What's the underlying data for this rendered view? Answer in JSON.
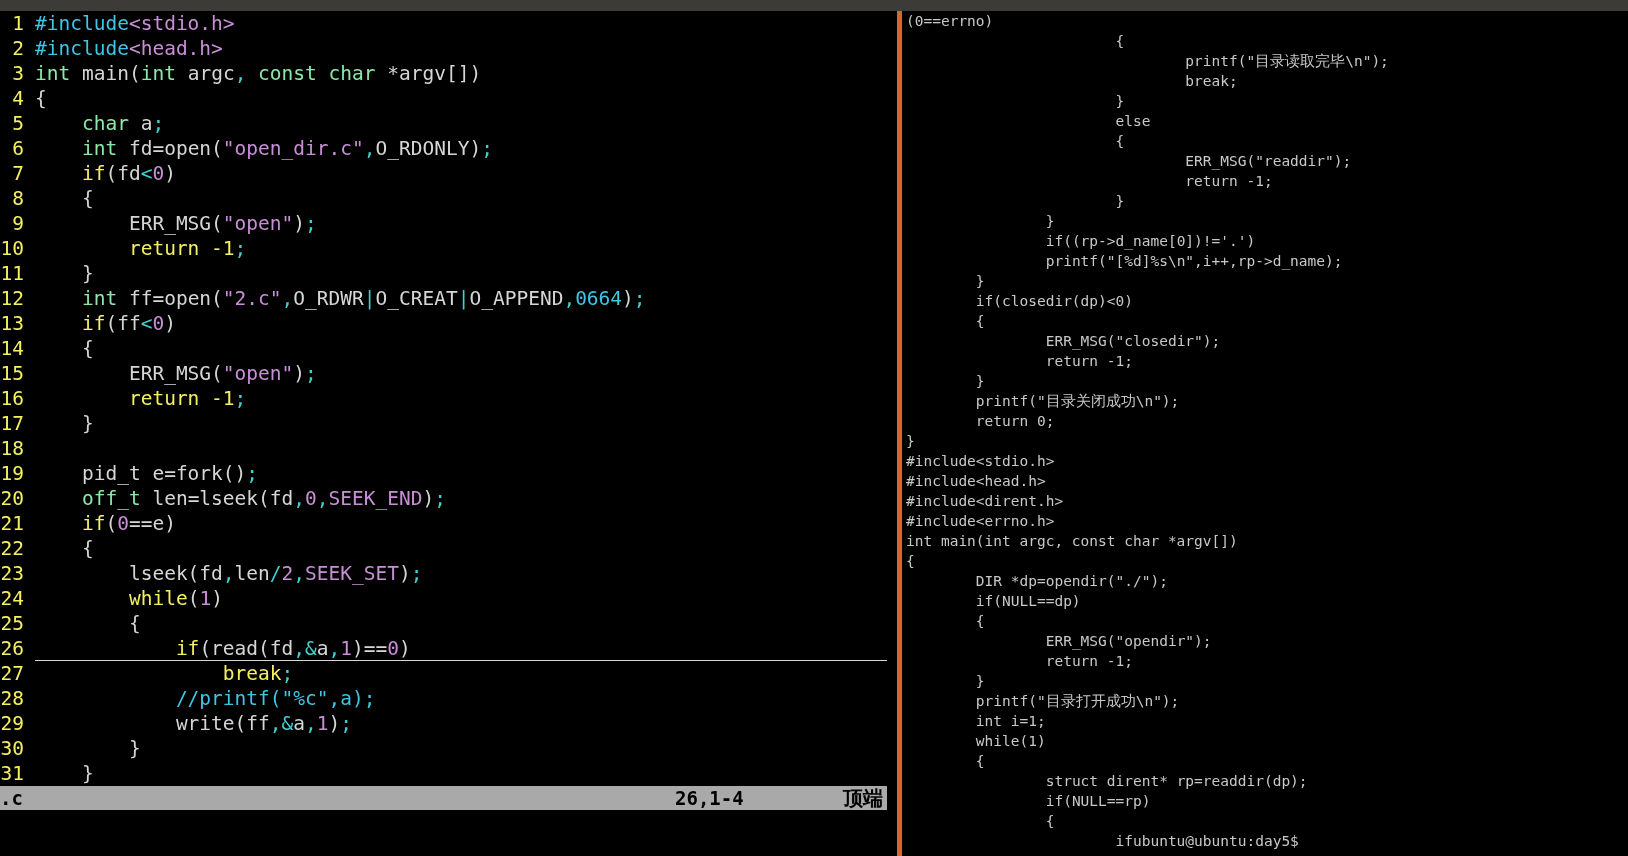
{
  "editor": {
    "lines": [
      {
        "number": "1",
        "segments": [
          {
            "kind": "preproc",
            "text": "#include"
          },
          {
            "kind": "string",
            "text": "<stdio.h>"
          }
        ]
      },
      {
        "number": "2",
        "segments": [
          {
            "kind": "preproc",
            "text": "#include"
          },
          {
            "kind": "string",
            "text": "<head.h>"
          }
        ]
      },
      {
        "number": "3",
        "segments": [
          {
            "kind": "type",
            "text": "int"
          },
          {
            "kind": "plain",
            "text": " main("
          },
          {
            "kind": "type",
            "text": "int"
          },
          {
            "kind": "plain",
            "text": " argc"
          },
          {
            "kind": "punct",
            "text": ", "
          },
          {
            "kind": "type",
            "text": "const char"
          },
          {
            "kind": "plain",
            "text": " *argv[])"
          }
        ]
      },
      {
        "number": "4",
        "segments": [
          {
            "kind": "plain",
            "text": "{"
          }
        ]
      },
      {
        "number": "5",
        "segments": [
          {
            "kind": "type",
            "text": "    char"
          },
          {
            "kind": "plain",
            "text": " a"
          },
          {
            "kind": "punct",
            "text": ";"
          }
        ]
      },
      {
        "number": "6",
        "segments": [
          {
            "kind": "type",
            "text": "    int"
          },
          {
            "kind": "plain",
            "text": " fd=open("
          },
          {
            "kind": "string",
            "text": "\"open_dir.c\""
          },
          {
            "kind": "punct",
            "text": ","
          },
          {
            "kind": "plain",
            "text": "O_RDONLY)"
          },
          {
            "kind": "punct",
            "text": ";"
          }
        ]
      },
      {
        "number": "7",
        "segments": [
          {
            "kind": "statement",
            "text": "    if"
          },
          {
            "kind": "plain",
            "text": "(fd"
          },
          {
            "kind": "punct",
            "text": "<"
          },
          {
            "kind": "number",
            "text": "0"
          },
          {
            "kind": "plain",
            "text": ")"
          }
        ]
      },
      {
        "number": "8",
        "segments": [
          {
            "kind": "plain",
            "text": "    {"
          }
        ]
      },
      {
        "number": "9",
        "segments": [
          {
            "kind": "plain",
            "text": "        ERR_MSG("
          },
          {
            "kind": "string",
            "text": "\"open\""
          },
          {
            "kind": "plain",
            "text": ")"
          },
          {
            "kind": "punct",
            "text": ";"
          }
        ]
      },
      {
        "number": "10",
        "segments": [
          {
            "kind": "statement",
            "text": "        return -1"
          },
          {
            "kind": "punct",
            "text": ";"
          }
        ]
      },
      {
        "number": "11",
        "segments": [
          {
            "kind": "plain",
            "text": "    }"
          }
        ]
      },
      {
        "number": "12",
        "segments": [
          {
            "kind": "type",
            "text": "    int"
          },
          {
            "kind": "plain",
            "text": " ff=open("
          },
          {
            "kind": "string",
            "text": "\"2.c\""
          },
          {
            "kind": "punct",
            "text": ","
          },
          {
            "kind": "plain",
            "text": "O_RDWR"
          },
          {
            "kind": "punct",
            "text": "|"
          },
          {
            "kind": "plain",
            "text": "O_CREAT"
          },
          {
            "kind": "punct",
            "text": "|"
          },
          {
            "kind": "plain",
            "text": "O_APPEND"
          },
          {
            "kind": "punct",
            "text": ","
          },
          {
            "kind": "octal",
            "text": "0664"
          },
          {
            "kind": "plain",
            "text": ")"
          },
          {
            "kind": "punct",
            "text": ";"
          }
        ]
      },
      {
        "number": "13",
        "segments": [
          {
            "kind": "statement",
            "text": "    if"
          },
          {
            "kind": "plain",
            "text": "(ff"
          },
          {
            "kind": "punct",
            "text": "<"
          },
          {
            "kind": "number",
            "text": "0"
          },
          {
            "kind": "plain",
            "text": ")"
          }
        ]
      },
      {
        "number": "14",
        "segments": [
          {
            "kind": "plain",
            "text": "    {"
          }
        ]
      },
      {
        "number": "15",
        "segments": [
          {
            "kind": "plain",
            "text": "        ERR_MSG("
          },
          {
            "kind": "string",
            "text": "\"open\""
          },
          {
            "kind": "plain",
            "text": ")"
          },
          {
            "kind": "punct",
            "text": ";"
          }
        ]
      },
      {
        "number": "16",
        "segments": [
          {
            "kind": "statement",
            "text": "        return -1"
          },
          {
            "kind": "punct",
            "text": ";"
          }
        ]
      },
      {
        "number": "17",
        "segments": [
          {
            "kind": "plain",
            "text": "    }"
          }
        ]
      },
      {
        "number": "18"
      },
      {
        "number": "19",
        "segments": [
          {
            "kind": "plain",
            "text": "    pid_t e=fork()"
          },
          {
            "kind": "punct",
            "text": ";"
          }
        ]
      },
      {
        "number": "20",
        "segments": [
          {
            "kind": "type",
            "text": "    off_t"
          },
          {
            "kind": "plain",
            "text": " len=lseek(fd"
          },
          {
            "kind": "punct",
            "text": ","
          },
          {
            "kind": "number",
            "text": "0"
          },
          {
            "kind": "punct",
            "text": ","
          },
          {
            "kind": "number",
            "text": "SEEK_END"
          },
          {
            "kind": "plain",
            "text": ")"
          },
          {
            "kind": "punct",
            "text": ";"
          }
        ]
      },
      {
        "number": "21",
        "segments": [
          {
            "kind": "statement",
            "text": "    if"
          },
          {
            "kind": "plain",
            "text": "("
          },
          {
            "kind": "number",
            "text": "0"
          },
          {
            "kind": "plain",
            "text": "==e)"
          }
        ]
      },
      {
        "number": "22",
        "segments": [
          {
            "kind": "plain",
            "text": "    {"
          }
        ]
      },
      {
        "number": "23",
        "segments": [
          {
            "kind": "plain",
            "text": "        lseek(fd"
          },
          {
            "kind": "punct",
            "text": ","
          },
          {
            "kind": "plain",
            "text": "len"
          },
          {
            "kind": "punct",
            "text": "/"
          },
          {
            "kind": "number",
            "text": "2"
          },
          {
            "kind": "punct",
            "text": ","
          },
          {
            "kind": "number",
            "text": "SEEK_SET"
          },
          {
            "kind": "plain",
            "text": ")"
          },
          {
            "kind": "punct",
            "text": ";"
          }
        ]
      },
      {
        "number": "24",
        "segments": [
          {
            "kind": "statement",
            "text": "        while"
          },
          {
            "kind": "plain",
            "text": "("
          },
          {
            "kind": "number",
            "text": "1"
          },
          {
            "kind": "plain",
            "text": ")"
          }
        ]
      },
      {
        "number": "25",
        "segments": [
          {
            "kind": "plain",
            "text": "        {"
          }
        ]
      },
      {
        "number": "26",
        "cursorline": true,
        "segments": [
          {
            "kind": "statement",
            "text": "            if"
          },
          {
            "kind": "plain",
            "text": "(read(fd"
          },
          {
            "kind": "punct",
            "text": ",&"
          },
          {
            "kind": "plain",
            "text": "a"
          },
          {
            "kind": "punct",
            "text": ","
          },
          {
            "kind": "number",
            "text": "1"
          },
          {
            "kind": "plain",
            "text": ")=="
          },
          {
            "kind": "number",
            "text": "0"
          },
          {
            "kind": "plain",
            "text": ")"
          }
        ]
      },
      {
        "number": "27",
        "segments": [
          {
            "kind": "statement",
            "text": "                break"
          },
          {
            "kind": "punct",
            "text": ";"
          }
        ]
      },
      {
        "number": "28",
        "segments": [
          {
            "kind": "comment",
            "text": "            //printf(\"%c\",a);"
          }
        ]
      },
      {
        "number": "29",
        "segments": [
          {
            "kind": "plain",
            "text": "            write(ff"
          },
          {
            "kind": "punct",
            "text": ",&"
          },
          {
            "kind": "plain",
            "text": "a"
          },
          {
            "kind": "punct",
            "text": ","
          },
          {
            "kind": "number",
            "text": "1"
          },
          {
            "kind": "plain",
            "text": ")"
          },
          {
            "kind": "punct",
            "text": ";"
          }
        ]
      },
      {
        "number": "30",
        "segments": [
          {
            "kind": "plain",
            "text": "        }"
          }
        ]
      },
      {
        "number": "31",
        "segments": [
          {
            "kind": "plain",
            "text": "    }"
          }
        ]
      }
    ],
    "status_bar": {
      "file": ".c",
      "position": "26,1-4",
      "scroll": "顶端"
    }
  },
  "terminal": {
    "lines": [
      "(0==errno)",
      "\t\t\t{",
      "\t\t\t\tprintf(\"目录读取完毕\\n\");",
      "\t\t\t\tbreak;",
      "\t\t\t}",
      "\t\t\telse",
      "\t\t\t{",
      "\t\t\t\tERR_MSG(\"readdir\");",
      "\t\t\t\treturn -1;",
      "\t\t\t}",
      "\t\t}",
      "\t\tif((rp->d_name[0])!='.')",
      "\t\tprintf(\"[%d]%s\\n\",i++,rp->d_name);",
      "\t}",
      "\tif(closedir(dp)<0)",
      "\t{",
      "\t\tERR_MSG(\"closedir\");",
      "\t\treturn -1;",
      "\t}",
      "\tprintf(\"目录关闭成功\\n\");",
      "\treturn 0;",
      "}",
      "#include<stdio.h>",
      "#include<head.h>",
      "#include<dirent.h>",
      "#include<errno.h>",
      "int main(int argc, const char *argv[])",
      "{",
      "\tDIR *dp=opendir(\"./\");",
      "\tif(NULL==dp)",
      "\t{",
      "\t\tERR_MSG(\"opendir\");",
      "\t\treturn -1;",
      "\t}",
      "\tprintf(\"目录打开成功\\n\");",
      "\tint i=1;",
      "\twhile(1)",
      "\t{",
      "\t\tstruct dirent* rp=readdir(dp);",
      "\t\tif(NULL==rp)",
      "\t\t{",
      "\t\t\tifubuntu@ubuntu:day5$"
    ]
  }
}
